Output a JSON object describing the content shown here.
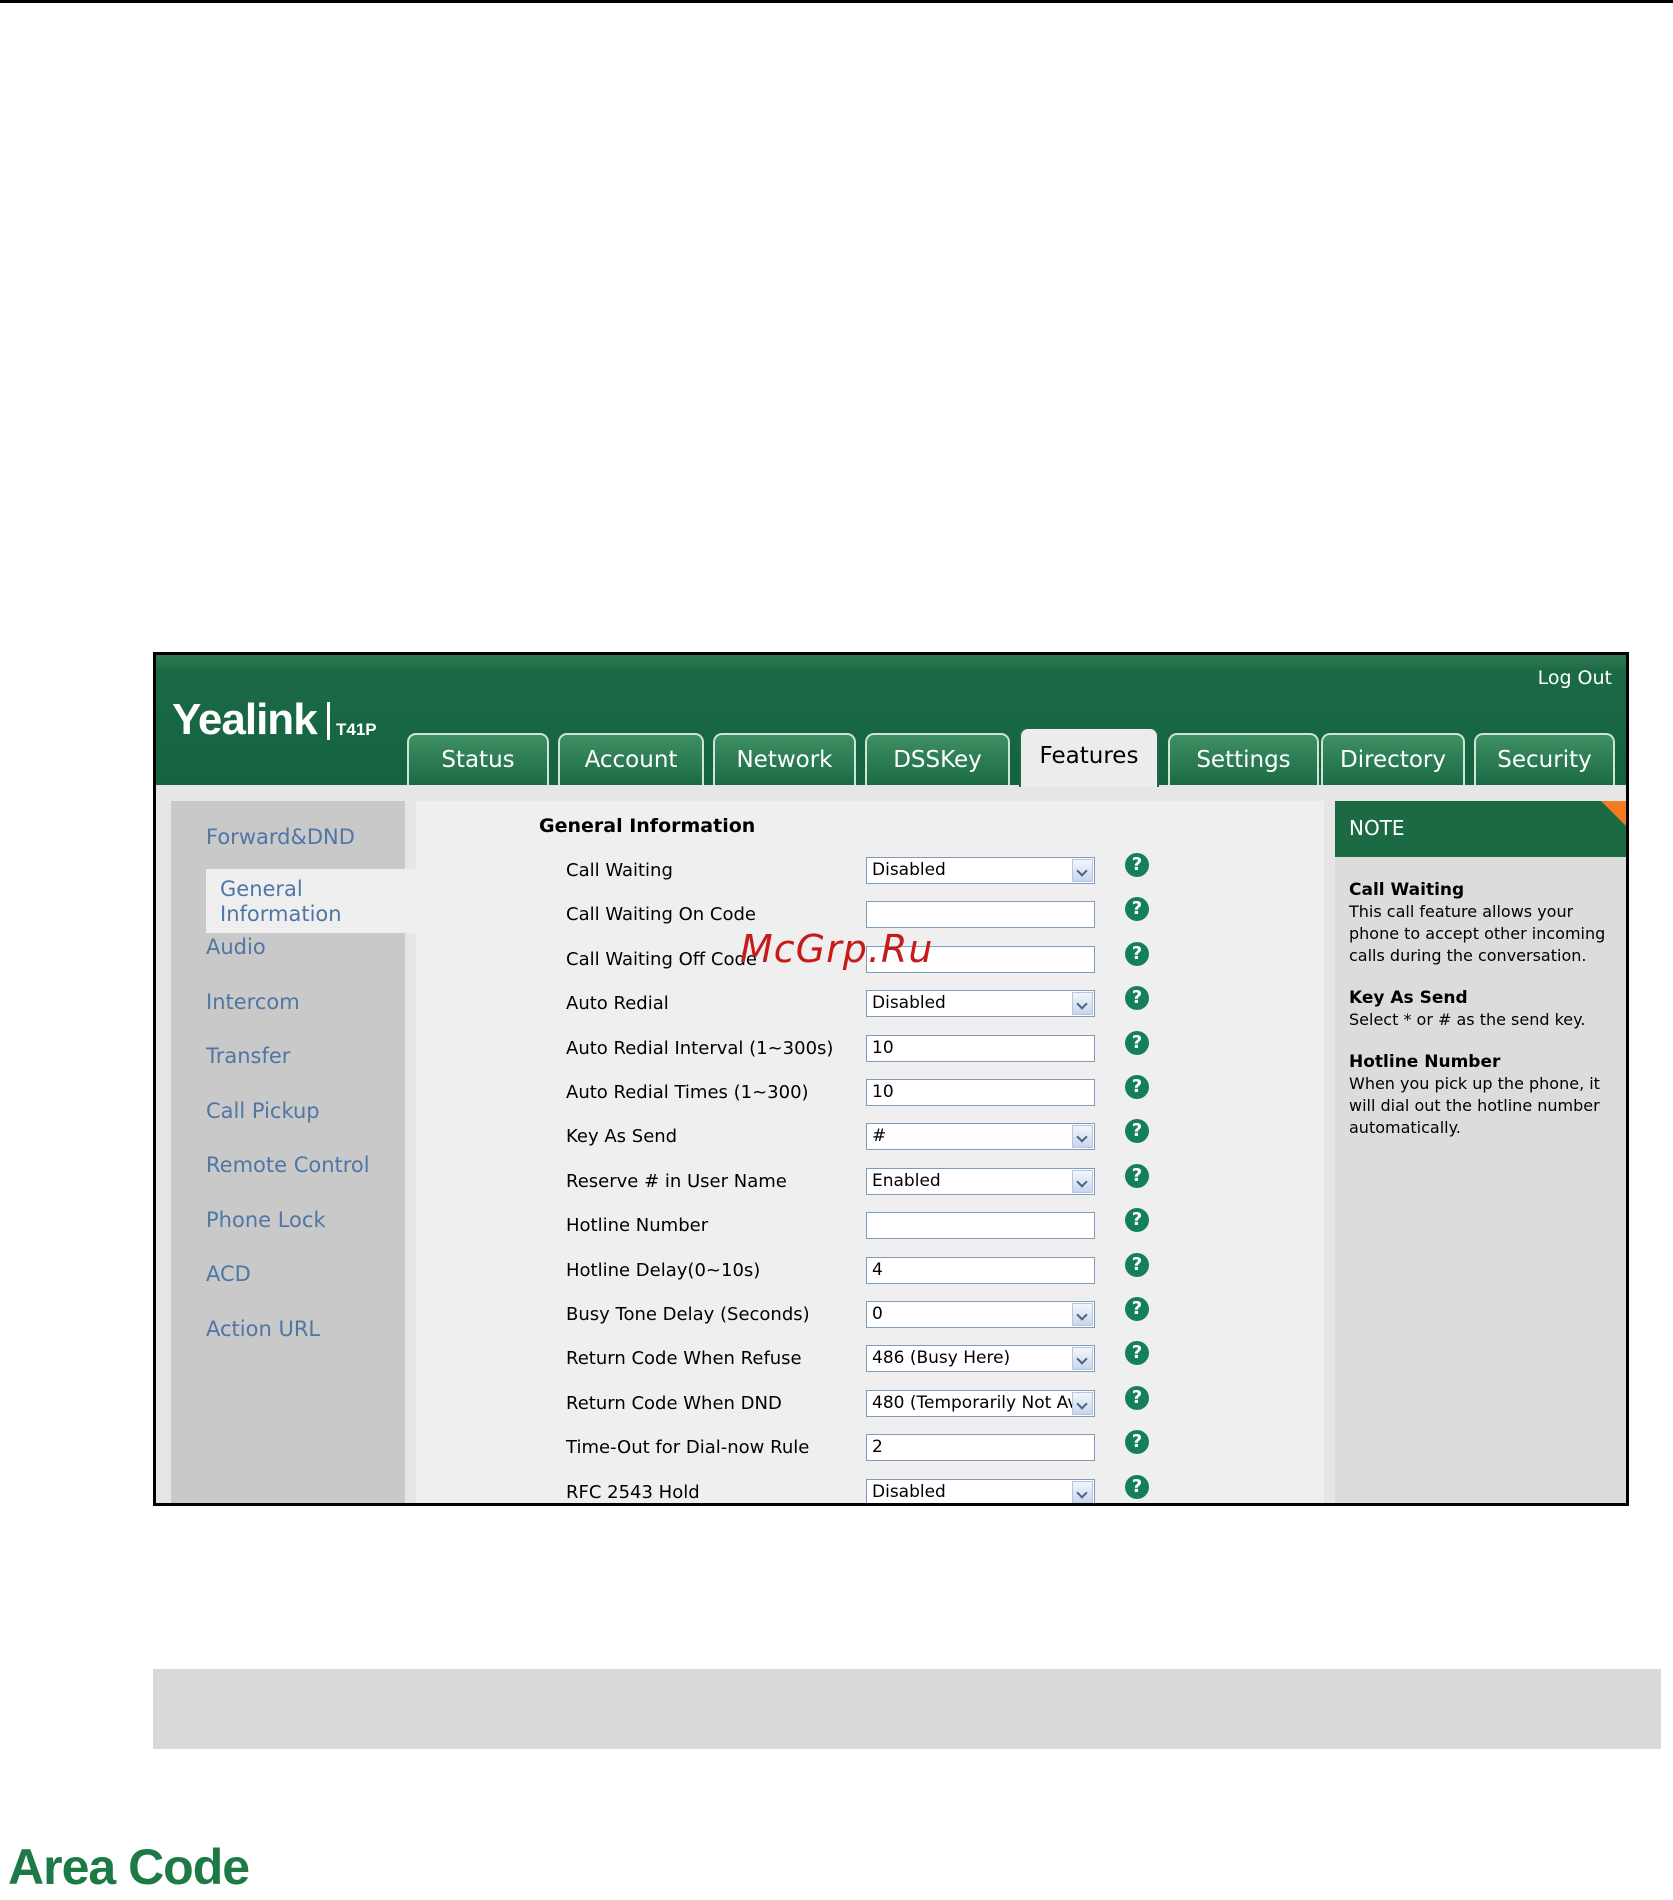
{
  "header": {
    "logout": "Log Out",
    "brand": "Yealink",
    "model": "T41P"
  },
  "tabs": [
    {
      "label": "Status"
    },
    {
      "label": "Account"
    },
    {
      "label": "Network"
    },
    {
      "label": "DSSKey"
    },
    {
      "label": "Features",
      "active": true
    },
    {
      "label": "Settings"
    },
    {
      "label": "Directory"
    },
    {
      "label": "Security"
    }
  ],
  "sidebar": {
    "items": [
      {
        "label": "Forward&DND"
      },
      {
        "label": "General Information",
        "active": true
      },
      {
        "label": "Audio"
      },
      {
        "label": "Intercom"
      },
      {
        "label": "Transfer"
      },
      {
        "label": "Call Pickup"
      },
      {
        "label": "Remote Control"
      },
      {
        "label": "Phone Lock"
      },
      {
        "label": "ACD"
      },
      {
        "label": "Action URL"
      }
    ],
    "active_line1": "General",
    "active_line2": "Information"
  },
  "form": {
    "section_title": "General Information",
    "rows": [
      {
        "label": "Call Waiting",
        "type": "select",
        "value": "Disabled"
      },
      {
        "label": "Call Waiting On Code",
        "type": "text",
        "value": ""
      },
      {
        "label": "Call Waiting Off Code",
        "type": "text",
        "value": ""
      },
      {
        "label": "Auto Redial",
        "type": "select",
        "value": "Disabled"
      },
      {
        "label": "Auto Redial Interval (1~300s)",
        "type": "text",
        "value": "10"
      },
      {
        "label": "Auto Redial Times (1~300)",
        "type": "text",
        "value": "10"
      },
      {
        "label": "Key As Send",
        "type": "select",
        "value": "#"
      },
      {
        "label": "Reserve # in User Name",
        "type": "select",
        "value": "Enabled"
      },
      {
        "label": "Hotline Number",
        "type": "text",
        "value": ""
      },
      {
        "label": "Hotline Delay(0~10s)",
        "type": "text",
        "value": "4"
      },
      {
        "label": "Busy Tone Delay (Seconds)",
        "type": "select",
        "value": "0"
      },
      {
        "label": "Return Code When Refuse",
        "type": "select",
        "value": "486 (Busy Here)"
      },
      {
        "label": "Return Code When DND",
        "type": "select",
        "value": "480 (Temporarily Not Av"
      },
      {
        "label": "Time-Out for Dial-now Rule",
        "type": "text",
        "value": "2"
      },
      {
        "label": "RFC 2543 Hold",
        "type": "select",
        "value": "Disabled"
      }
    ],
    "help_glyph": "?"
  },
  "note": {
    "title": "NOTE",
    "blocks": [
      {
        "title": "Call Waiting",
        "text": "This call feature allows your phone to accept other incoming calls during the conversation."
      },
      {
        "title": "Key As Send",
        "text": "Select * or # as the send key."
      },
      {
        "title": "Hotline Number",
        "text": "When you pick up the phone, it will dial out the hotline number automatically."
      }
    ]
  },
  "watermark": "McGrp.Ru",
  "page_heading": "Area Code",
  "colors": {
    "brand_green": "#136340",
    "link_blue": "#4f76a5",
    "help_green": "#14805a",
    "note_corner": "#f47b20",
    "heading_green": "#1d7a47"
  },
  "icons": {
    "help": "help-circle-icon",
    "dropdown": "chevron-down-icon"
  }
}
